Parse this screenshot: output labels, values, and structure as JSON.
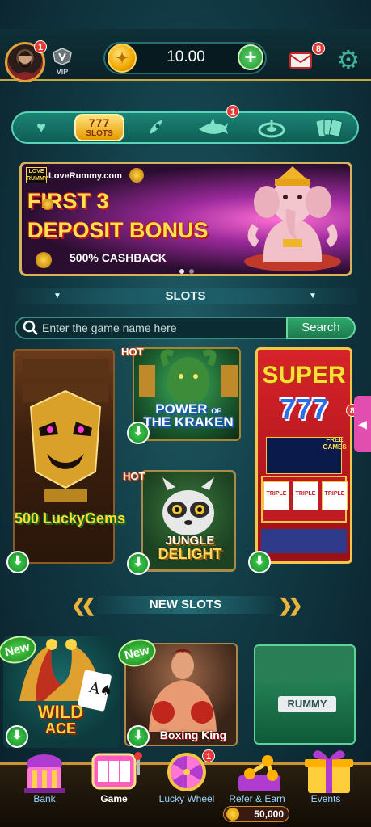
{
  "header": {
    "avatar_badge": "1",
    "vip_label": "VIP",
    "balance": "10.00",
    "add_label": "+",
    "mail_badge": "8"
  },
  "categories": {
    "slots_label": "SLOTS",
    "fish_badge": "1",
    "items": [
      "favorites",
      "slots",
      "rocket",
      "fish",
      "roulette",
      "cards"
    ]
  },
  "banner": {
    "brand_logo": "LOVE RUMMY",
    "brand": "LoveRummy.com",
    "line1": "FIRST 3",
    "line2": "DEPOSIT BONUS",
    "line3": "500% CASHBACK"
  },
  "slots_section": {
    "title": "SLOTS",
    "search_placeholder": "Enter the game name here",
    "search_button": "Search"
  },
  "games": {
    "lucky_gems": "500 LuckyGems",
    "kraken_line1": "POWER",
    "kraken_line2": "OF",
    "kraken_line3": "THE KRAKEN",
    "kraken_hot": "HOT",
    "jungle_line1": "JUNGLE",
    "jungle_line2": "DELIGHT",
    "jungle_hot": "HOT",
    "super_title": "SUPER",
    "super_777": "777",
    "super_badge": "8",
    "super_side": "FREE GAMES",
    "triple": "TRIPLE"
  },
  "new_slots": {
    "title": "NEW SLOTS",
    "new_tag": "New",
    "wild_line1": "WILD",
    "wild_line2": "ACE",
    "boxing": "Boxing King",
    "rummy": "RUMMY"
  },
  "nav": {
    "bank": "Bank",
    "game": "Game",
    "lucky_wheel": "Lucky Wheel",
    "lucky_wheel_badge": "1",
    "refer": "Refer & Earn",
    "events": "Events",
    "points": "50,000"
  },
  "colors": {
    "accent_gold": "#c9a54a",
    "accent_teal": "#1b8474",
    "download_green": "#22932f",
    "badge_red": "#e53935"
  }
}
